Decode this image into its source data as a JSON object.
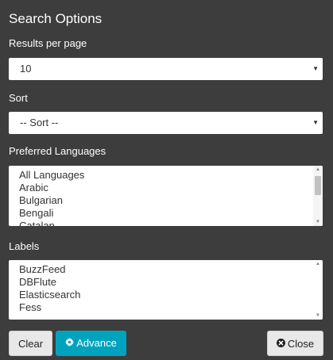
{
  "panel": {
    "title": "Search Options"
  },
  "results_per_page": {
    "label": "Results per page",
    "value": "10"
  },
  "sort": {
    "label": "Sort",
    "value": "-- Sort --"
  },
  "languages": {
    "label": "Preferred Languages",
    "options": [
      "All Languages",
      "Arabic",
      "Bulgarian",
      "Bengali",
      "Catalan"
    ]
  },
  "labels": {
    "label": "Labels",
    "options": [
      "BuzzFeed",
      "DBFlute",
      "Elasticsearch",
      "Fess"
    ]
  },
  "buttons": {
    "clear": "Clear",
    "advance": "Advance",
    "close": "Close"
  },
  "colors": {
    "panel_bg": "#3d3d3d",
    "accent": "#00a3be"
  },
  "icons": {
    "advance": "gear-icon",
    "close": "close-circle-icon",
    "select_arrow": "caret-down-icon"
  }
}
